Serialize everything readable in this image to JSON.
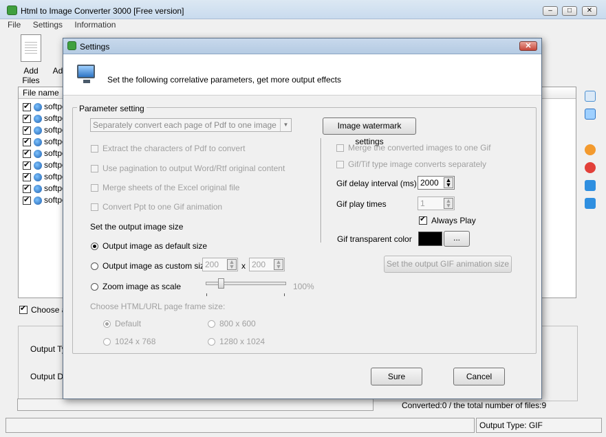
{
  "app": {
    "title": "Html to Image Converter 3000 [Free version]"
  },
  "menu": [
    "File",
    "Settings",
    "Information"
  ],
  "toolbar": {
    "add_files": "Add Files",
    "add_partial": "Ad"
  },
  "filelist": {
    "header": "File name",
    "rows": [
      "softpe",
      "softpe",
      "softpe",
      "softpe",
      "softpe",
      "softpe",
      "softpe",
      "softpe",
      "softpe"
    ]
  },
  "main": {
    "choose_label": "Choose a",
    "output_type_label": "Output Ty",
    "output_dir_label": "Output Di"
  },
  "status": {
    "converted": "Converted:0  /  the total number of files:9",
    "output_type": "Output Type: GIF"
  },
  "dialog": {
    "title": "Settings",
    "header_text": "Set the following correlative parameters, get more output effects",
    "group_label": "Parameter setting",
    "pdf_combo": "Separately convert each page of Pdf to one image",
    "watermark_button": "Image watermark settings",
    "left_options": [
      "Extract the characters of Pdf to convert",
      "Use pagination to output Word/Rtf original content",
      "Merge sheets of the Excel original file",
      "Convert Ppt to one Gif animation"
    ],
    "size_heading": "Set the output image size",
    "size_default": "Output image as default size",
    "size_custom": "Output image as custom size",
    "custom_w": "200",
    "custom_x": "x",
    "custom_h": "200",
    "zoom_label": "Zoom image as scale",
    "zoom_value": "100%",
    "zoom_level": 1.0,
    "frame_heading": "Choose HTML/URL page frame size:",
    "frame_options": [
      "Default",
      "800 x 600",
      "1024 x 768",
      "1280 x 1024"
    ],
    "right_options": [
      "Merge the converted images to one Gif",
      "Gif/Tif type image converts separately"
    ],
    "gif_delay_label": "Gif delay interval (ms)",
    "gif_delay_value": "2000",
    "gif_play_label": "Gif play times",
    "gif_play_value": "1",
    "always_play": "Always Play",
    "transparent_label": "Gif transparent color",
    "transparent_color": "#000000",
    "color_button": "...",
    "gif_size_button": "Set the output GIF animation size",
    "ok_button": "Sure",
    "cancel_button": "Cancel"
  }
}
